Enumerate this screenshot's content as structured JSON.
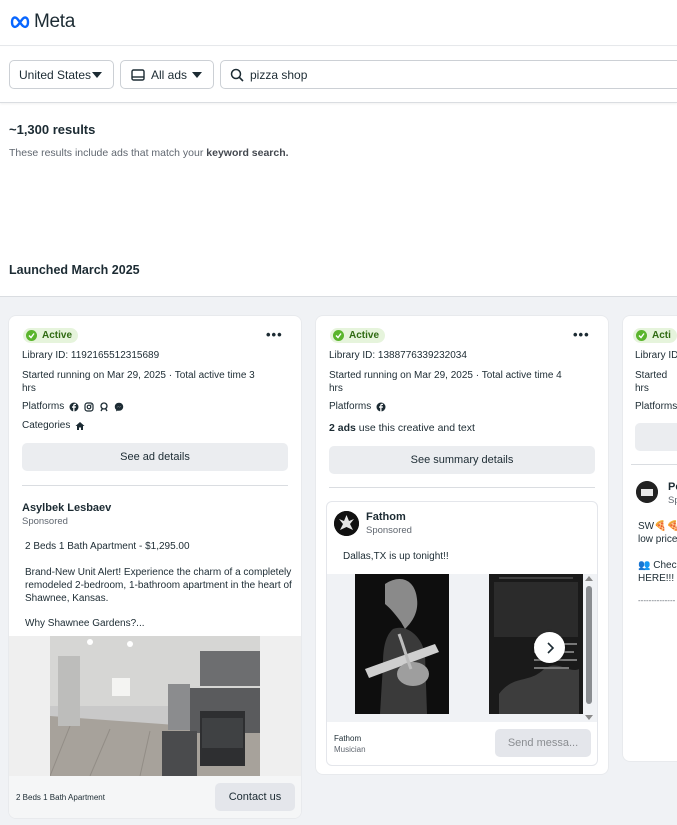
{
  "header": {
    "brand": "Meta"
  },
  "filters": {
    "country": "United States",
    "ad_type": "All ads",
    "search_value": "pizza shop"
  },
  "results": {
    "count": "~1,300 results",
    "note_prefix": "These results include ads that match your ",
    "note_bold": "keyword search."
  },
  "section": {
    "title": "Launched March 2025"
  },
  "cards": [
    {
      "status": "Active",
      "library_id": "Library ID: 1192165512315689",
      "started_line1": "Started running on Mar 29, 2025 · Total active time 3",
      "started_line2": "hrs",
      "platforms_label": "Platforms",
      "categories_label": "Categories",
      "details_button": "See ad details",
      "advertiser": "Asylbek Lesbaev",
      "sponsored": "Sponsored",
      "headline": "2 Beds 1 Bath Apartment - $1,295.00",
      "body1": "Brand-New Unit Alert! Experience the charm of a completely remodeled 2-bedroom, 1-bathroom apartment in the heart of Shawnee, Kansas.",
      "body2": "Why Shawnee Gardens?...",
      "cta_caption": "2 Beds 1 Bath Apartment",
      "cta_button": "Contact us"
    },
    {
      "status": "Active",
      "library_id": "Library ID: 1388776339232034",
      "started_line1": "Started running on Mar 29, 2025 · Total active time 4",
      "started_line2": "hrs",
      "platforms_label": "Platforms",
      "ads_count": "2 ads",
      "ads_count_rest": " use this creative and text",
      "details_button": "See summary details",
      "advertiser": "Fathom",
      "sponsored": "Sponsored",
      "body1": "Dallas,TX is up tonight!!",
      "footer_name": "Fathom",
      "footer_category": "Musician",
      "cta_button": "Send messa..."
    },
    {
      "status": "Acti",
      "library_id": "Library ID:",
      "started_line1": "Started",
      "started_line2": "hrs",
      "platforms_label": "Platforms",
      "advertiser": "Pe",
      "sponsored": "Sp",
      "body1": "SW🍕🍕",
      "body2": "low price",
      "body3": "👥 Check",
      "body4": "HERE!!!",
      "body5": "--------------"
    }
  ],
  "icons": {
    "meta_logo": "meta-infinity-logo",
    "search": "search-icon",
    "platform_facebook": "facebook-icon",
    "platform_instagram": "instagram-icon",
    "platform_audience_network": "audience-network-icon",
    "platform_messenger": "messenger-icon",
    "category_housing": "house-icon"
  },
  "colors": {
    "active_badge_bg": "#e6f4dc",
    "active_dot": "#5ab52c",
    "meta_blue": "#0866ff"
  }
}
